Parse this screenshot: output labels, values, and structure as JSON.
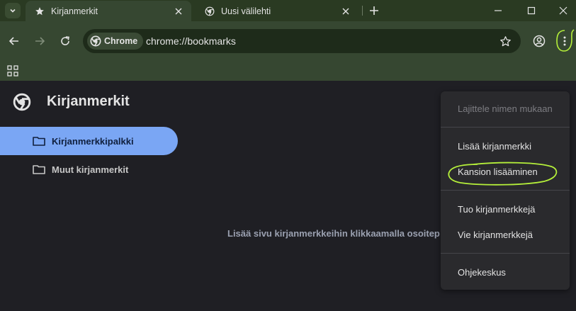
{
  "tabs": [
    {
      "title": "Kirjanmerkit",
      "favicon": "star-icon",
      "active": true
    },
    {
      "title": "Uusi välilehti",
      "favicon": "chrome-icon",
      "active": false
    }
  ],
  "omnibox": {
    "chip_label": "Chrome",
    "url": "chrome://bookmarks"
  },
  "page": {
    "title": "Kirjanmerkit",
    "folders": [
      {
        "label": "Kirjanmerkkipalkki",
        "selected": true
      },
      {
        "label": "Muut kirjanmerkit",
        "selected": false
      }
    ],
    "empty_message": "Lisää sivu kirjanmerkkeihin klikkaamalla osoitep"
  },
  "menu": {
    "items": [
      {
        "label": "Lajittele nimen mukaan",
        "disabled": true
      },
      {
        "label": "Lisää kirjanmerkki",
        "disabled": false
      },
      {
        "label": "Kansion lisääminen",
        "disabled": false,
        "highlighted": true
      },
      {
        "label": "Tuo kirjanmerkkejä",
        "disabled": false
      },
      {
        "label": "Vie kirjanmerkkejä",
        "disabled": false
      },
      {
        "label": "Ohjekeskus",
        "disabled": false
      }
    ]
  },
  "colors": {
    "frame": "#2a3a22",
    "toolbar": "#364731",
    "selected_folder": "#7aa6f4",
    "annotation": "#b5f03a",
    "page_bg": "#1f1f24"
  }
}
